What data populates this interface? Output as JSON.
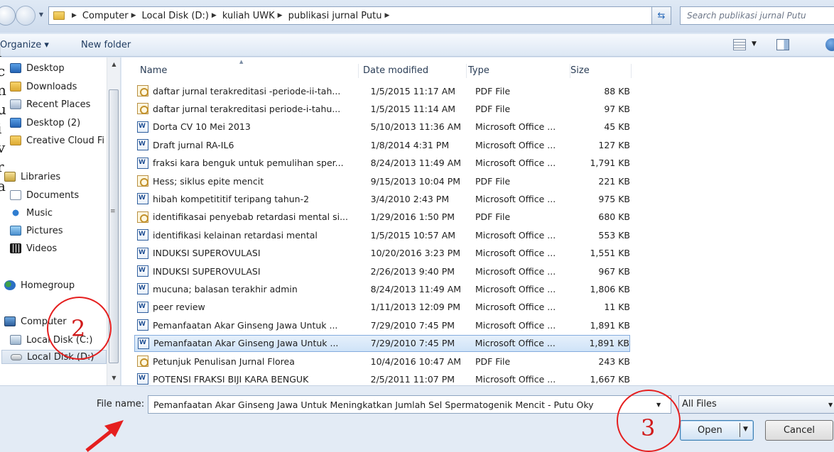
{
  "address_bar": {
    "crumbs": [
      "Computer",
      "Local Disk (D:)",
      "kuliah UWK",
      "publikasi jurnal Putu"
    ],
    "search_placeholder": "Search publikasi jurnal Putu"
  },
  "toolbar": {
    "organize": "Organize ▾",
    "new_folder": "New folder"
  },
  "nav_pane": {
    "items": [
      {
        "label": "Desktop",
        "icon": "desktop-icon"
      },
      {
        "label": "Downloads",
        "icon": "downloads-folder-icon"
      },
      {
        "label": "Recent Places",
        "icon": "recent-places-icon"
      },
      {
        "label": "Desktop (2)",
        "icon": "desktop-icon"
      },
      {
        "label": "Creative Cloud Fi",
        "icon": "folder-icon"
      },
      {
        "label": "Libraries",
        "icon": "libraries-icon"
      },
      {
        "label": "Documents",
        "icon": "documents-icon"
      },
      {
        "label": "Music",
        "icon": "music-icon"
      },
      {
        "label": "Pictures",
        "icon": "pictures-icon"
      },
      {
        "label": "Videos",
        "icon": "videos-icon"
      },
      {
        "label": "Homegroup",
        "icon": "homegroup-icon"
      },
      {
        "label": "Computer",
        "icon": "computer-icon"
      },
      {
        "label": "Local Disk (C:)",
        "icon": "local-disk-c-icon"
      },
      {
        "label": "Local Disk (D:)",
        "icon": "local-disk-d-icon"
      }
    ]
  },
  "columns": {
    "name": "Name",
    "date": "Date modified",
    "type": "Type",
    "size": "Size"
  },
  "files": [
    {
      "name": "daftar jurnal terakreditasi -periode-ii-tah...",
      "date": "1/5/2015 11:17 AM",
      "type": "PDF File",
      "size": "88 KB",
      "icon": "pdf"
    },
    {
      "name": "daftar jurnal terakreditasi periode-i-tahu...",
      "date": "1/5/2015 11:14 AM",
      "type": "PDF File",
      "size": "97 KB",
      "icon": "pdf"
    },
    {
      "name": "Dorta CV 10 Mei 2013",
      "date": "5/10/2013 11:36 AM",
      "type": "Microsoft Office ...",
      "size": "45 KB",
      "icon": "word"
    },
    {
      "name": "Draft jurnal RA-IL6",
      "date": "1/8/2014 4:31 PM",
      "type": "Microsoft Office ...",
      "size": "127 KB",
      "icon": "word"
    },
    {
      "name": "fraksi kara benguk untuk pemulihan sper...",
      "date": "8/24/2013 11:49 AM",
      "type": "Microsoft Office ...",
      "size": "1,791 KB",
      "icon": "word"
    },
    {
      "name": "Hess; siklus epite mencit",
      "date": "9/15/2013 10:04 PM",
      "type": "PDF File",
      "size": "221 KB",
      "icon": "pdf"
    },
    {
      "name": "hibah kompetititif teripang tahun-2",
      "date": "3/4/2010 2:43 PM",
      "type": "Microsoft Office ...",
      "size": "975 KB",
      "icon": "word"
    },
    {
      "name": "identifikasai penyebab retardasi mental si...",
      "date": "1/29/2016 1:50 PM",
      "type": "PDF File",
      "size": "680 KB",
      "icon": "pdf"
    },
    {
      "name": "identifikasi kelainan retardasi mental",
      "date": "1/5/2015 10:57 AM",
      "type": "Microsoft Office ...",
      "size": "553 KB",
      "icon": "word"
    },
    {
      "name": "INDUKSI SUPEROVULASI",
      "date": "10/20/2016 3:23 PM",
      "type": "Microsoft Office ...",
      "size": "1,551 KB",
      "icon": "word"
    },
    {
      "name": "INDUKSI SUPEROVULASI",
      "date": "2/26/2013 9:40 PM",
      "type": "Microsoft Office ...",
      "size": "967 KB",
      "icon": "word"
    },
    {
      "name": "mucuna; balasan terakhir admin",
      "date": "8/24/2013 11:49 AM",
      "type": "Microsoft Office ...",
      "size": "1,806 KB",
      "icon": "word"
    },
    {
      "name": "peer review",
      "date": "1/11/2013 12:09 PM",
      "type": "Microsoft Office ...",
      "size": "11 KB",
      "icon": "word"
    },
    {
      "name": "Pemanfaatan Akar Ginseng Jawa Untuk ...",
      "date": "7/29/2010 7:45 PM",
      "type": "Microsoft Office ...",
      "size": "1,891 KB",
      "icon": "word"
    },
    {
      "name": "Pemanfaatan Akar Ginseng Jawa Untuk ...",
      "date": "7/29/2010 7:45 PM",
      "type": "Microsoft Office ...",
      "size": "1,891 KB",
      "icon": "word",
      "selected": true
    },
    {
      "name": "Petunjuk Penulisan Jurnal Florea",
      "date": "10/4/2016 10:47 AM",
      "type": "PDF File",
      "size": "243 KB",
      "icon": "pdf"
    },
    {
      "name": "POTENSI FRAKSI BIJI KARA BENGUK",
      "date": "2/5/2011 11:07 PM",
      "type": "Microsoft Office ...",
      "size": "1,667 KB",
      "icon": "word"
    }
  ],
  "bottom": {
    "file_name_label": "File name:",
    "file_name_value": "Pemanfaatan Akar Ginseng Jawa Untuk Meningkatkan Jumlah Sel Spermatogenik Mencit - Putu Oky",
    "filter": "All Files",
    "open": "Open",
    "cancel": "Cancel"
  },
  "annotations": {
    "two": "2",
    "three": "3",
    "color": "#e51f1f"
  }
}
